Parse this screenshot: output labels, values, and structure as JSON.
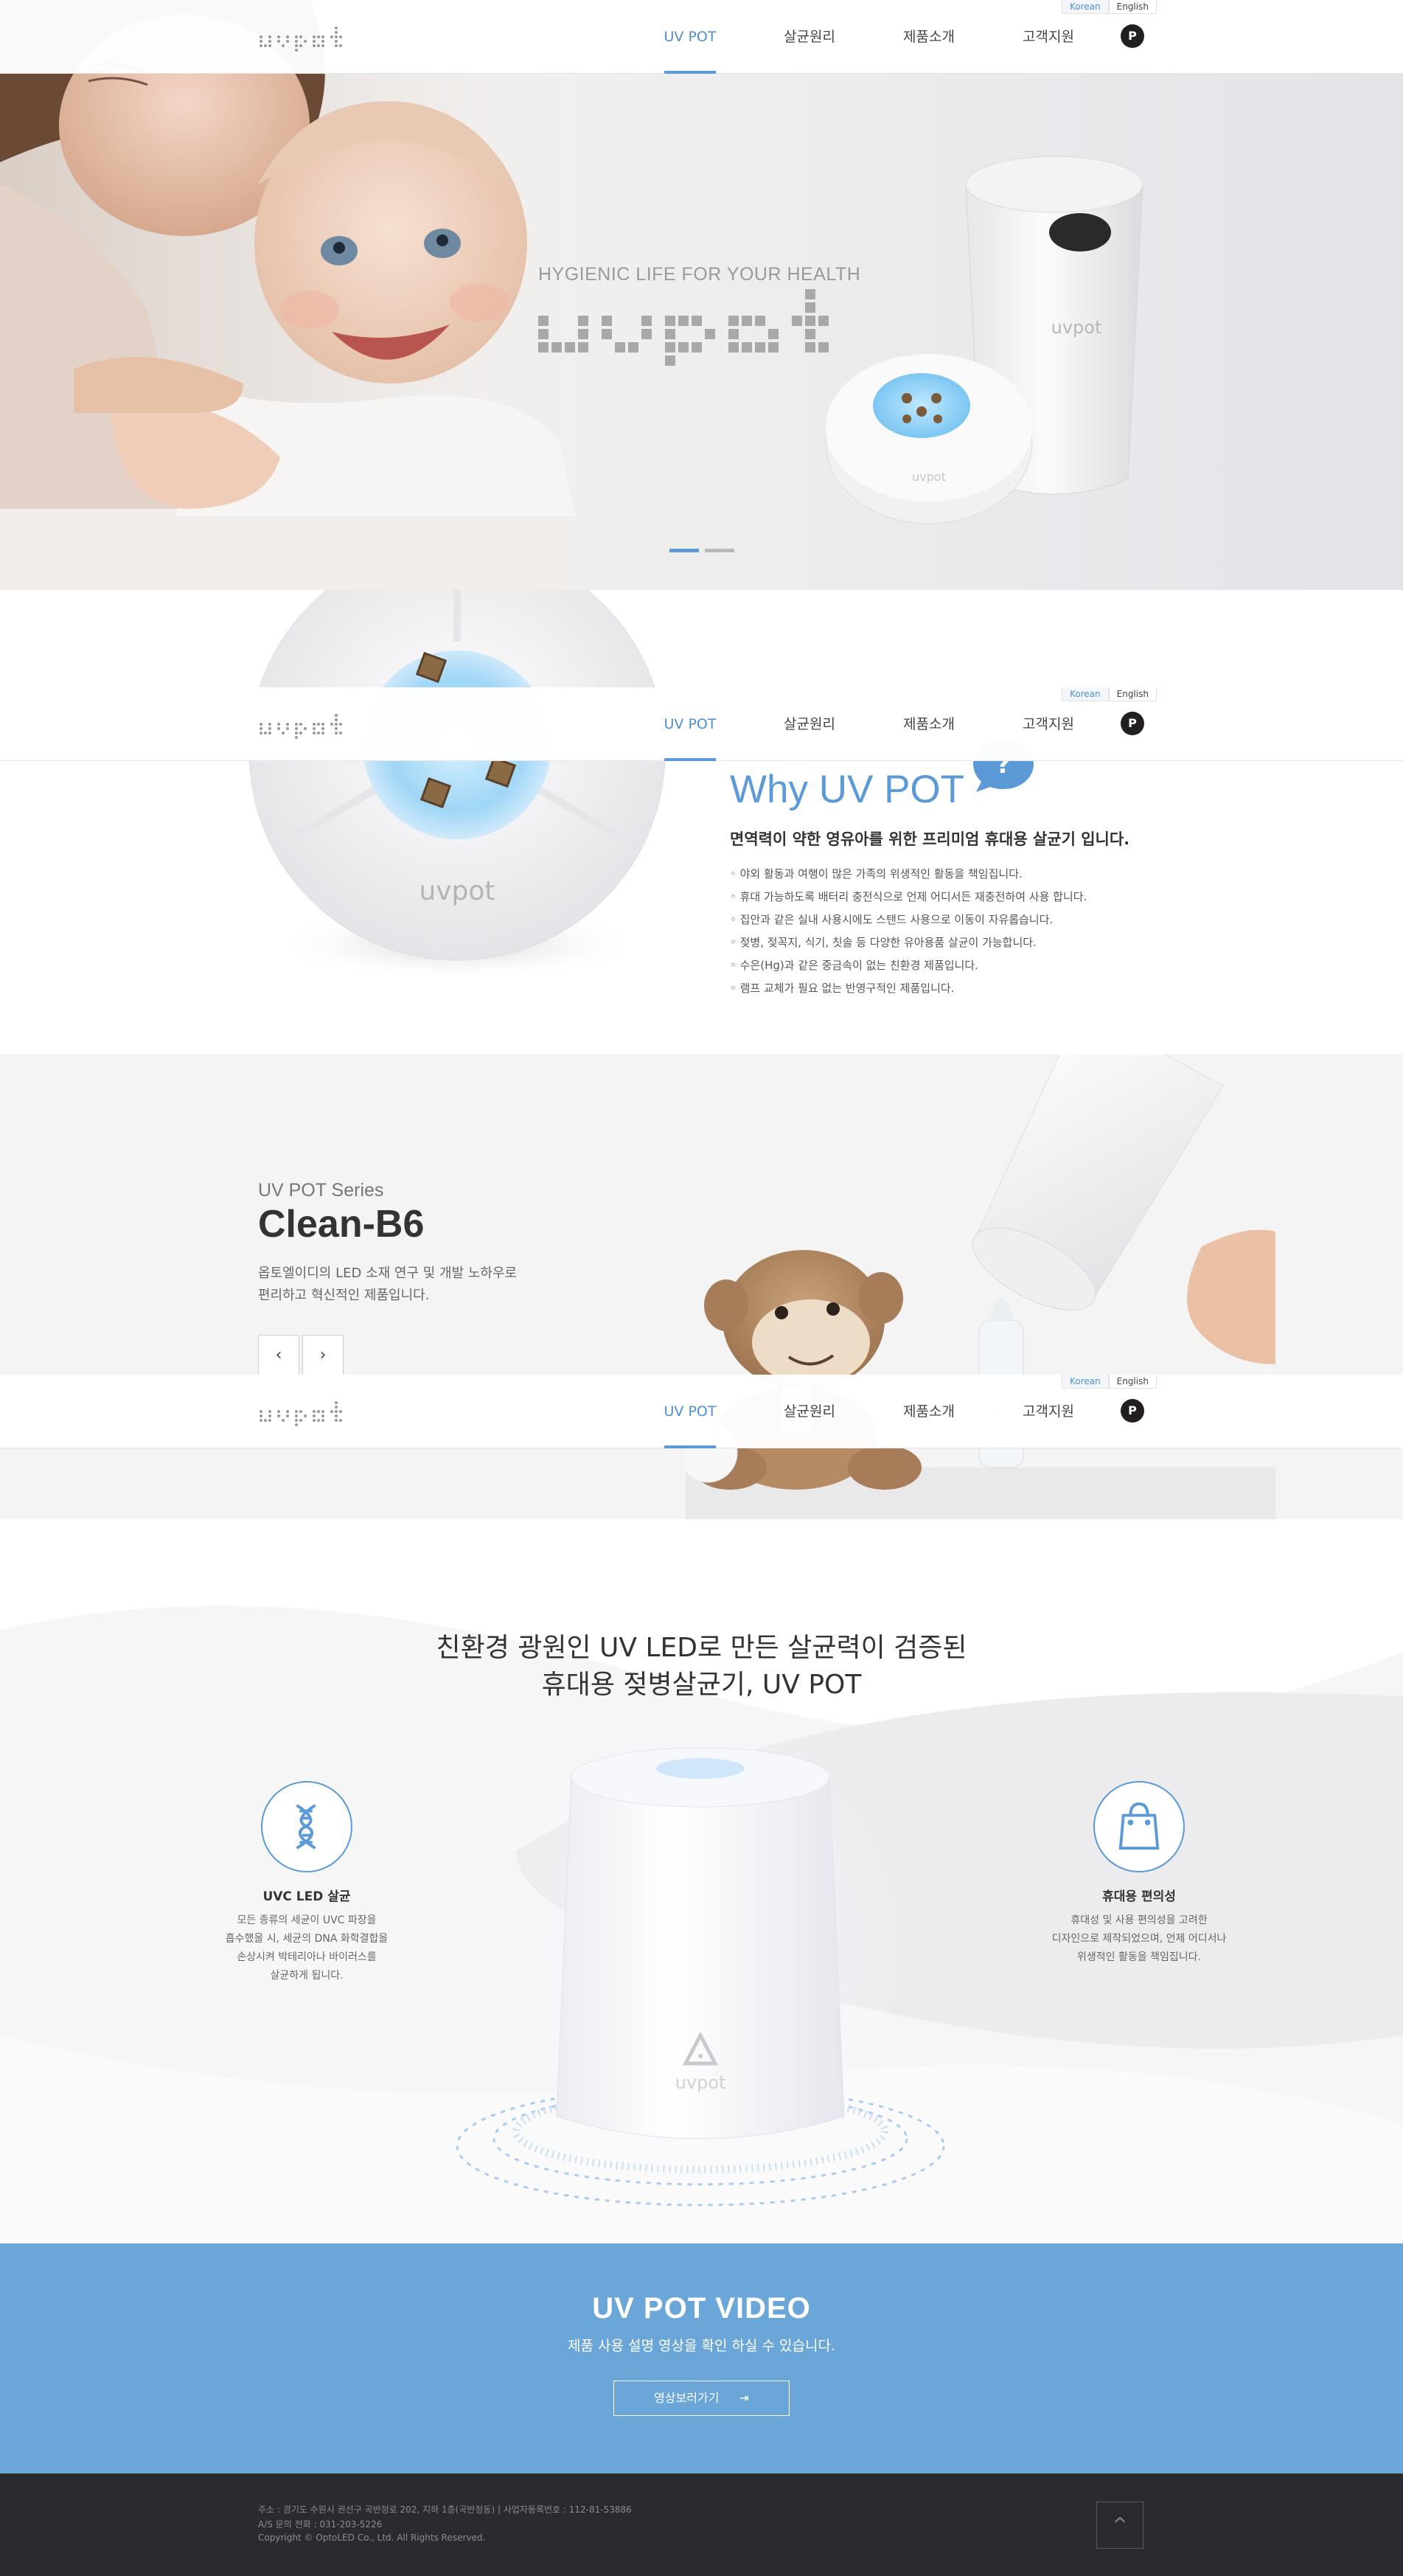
{
  "header": {
    "nav": [
      "UV POT",
      "살균원리",
      "제품소개",
      "고객지원"
    ],
    "lang_korean": "Korean",
    "lang_english": "English",
    "pbadge": "P"
  },
  "hero": {
    "tagline": "HYGIENIC LIFE FOR YOUR HEALTH",
    "active_slide": 1,
    "slide_count": 2
  },
  "why": {
    "title": "Why UV POT",
    "qmark": "?",
    "subtitle": "면역력이 약한 영유아를 위한 프리미엄 휴대용 살균기 입니다.",
    "items": [
      "야외 활동과 여행이 많은 가족의 위생적인 활동을 책임집니다.",
      "휴대 가능하도록 배터리 충전식으로 언제 어디서든 재충전하여 사용 합니다.",
      "집안과 같은 실내 사용시에도 스탠드 사용으로 이동이 자유롭습니다.",
      "젖병, 젖꼭지, 식기, 칫솔 등 다양한 유아용품 살균이 가능합니다.",
      "수은(Hg)과 같은 중금속이 없는 친환경 제품입니다.",
      "램프 교체가 필요 없는 반영구적인 제품입니다."
    ]
  },
  "series": {
    "label": "UV POT Series",
    "name": "Clean-B6",
    "desc_line1": "옵토엘이디의 LED 소재 연구 및 개발 노하우로",
    "desc_line2": "편리하고 혁신적인 제품입니다.",
    "prev": "‹",
    "next": "›"
  },
  "features": {
    "title_line1": "친환경 광원인 UV LED로 만든 살균력이 검증된",
    "title_line2": "휴대용 젖병살균기, UV POT",
    "left": {
      "name": "UVC LED 살균",
      "desc": [
        "모든 종류의 세균이 UVC 파장을",
        "흡수했을 시, 세균의 DNA 화학결합을",
        "손상시켜 박테리아나 바이러스를",
        "살균하게 됩니다."
      ]
    },
    "right": {
      "name": "휴대용 편의성",
      "desc": [
        "휴대성 및 사용 편의성을 고려한",
        "디자인으로 제작되었으며, 언제 어디서나",
        "위생적인 활동을 책임집니다."
      ]
    }
  },
  "video": {
    "title": "UV POT VIDEO",
    "subtitle": "제품 사용 설명 영상을 확인 하실 수 있습니다.",
    "button": "영상보러가기",
    "button_icon": "⇥"
  },
  "footer": {
    "line1": "주소 : 경기도 수원시 권선구 곡반정로 202, 지하 1층(곡반정동)  |  사업자등록번호 : 112-81-53886",
    "line2": "A/S 문의 전화 : 031-203-5226",
    "line3": "Copyright © OptoLED Co., Ltd. All Rights Reserved.",
    "top": "^"
  },
  "colors": {
    "accent": "#5b9ad6",
    "video_bg": "#6aa6d8",
    "footer_bg": "#2a2b30"
  }
}
